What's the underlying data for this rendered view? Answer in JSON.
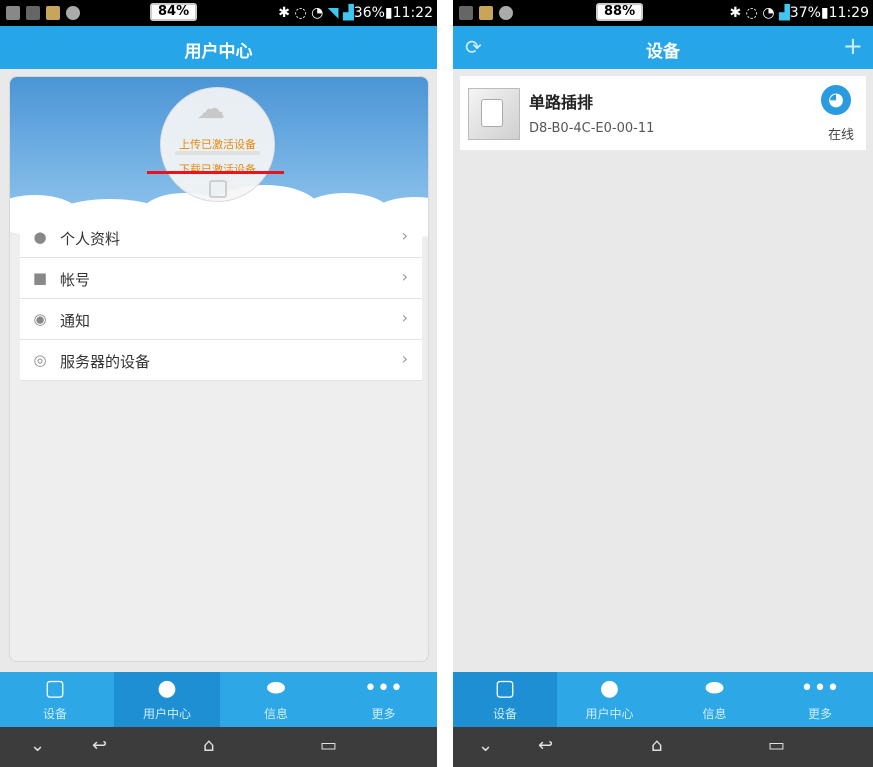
{
  "left": {
    "status": {
      "battery": "84%",
      "right": "36%",
      "time": "11:22"
    },
    "title": "用户中心",
    "banner": {
      "upload_label": "上传已激活设备",
      "download_label": "下载已激活设备"
    },
    "menu": [
      {
        "label": "个人资料",
        "icon": "person-icon"
      },
      {
        "label": "帐号",
        "icon": "lock-icon"
      },
      {
        "label": "通知",
        "icon": "chat-icon"
      },
      {
        "label": "服务器的设备",
        "icon": "signal-icon"
      }
    ],
    "tabs": [
      {
        "label": "设备"
      },
      {
        "label": "用户中心"
      },
      {
        "label": "信息"
      },
      {
        "label": "更多"
      }
    ]
  },
  "right": {
    "status": {
      "battery": "88%",
      "right": "37%",
      "time": "11:29"
    },
    "title": "设备",
    "device": {
      "name": "单路插排",
      "mac": "D8-B0-4C-E0-00-11",
      "status": "在线"
    },
    "tabs": [
      {
        "label": "设备"
      },
      {
        "label": "用户中心"
      },
      {
        "label": "信息"
      },
      {
        "label": "更多"
      }
    ]
  },
  "colors": {
    "header_blue": "#26a6e8",
    "tab_blue": "#2da7e6",
    "accent_orange": "#e8890c",
    "highlight_red": "#e8141c"
  }
}
